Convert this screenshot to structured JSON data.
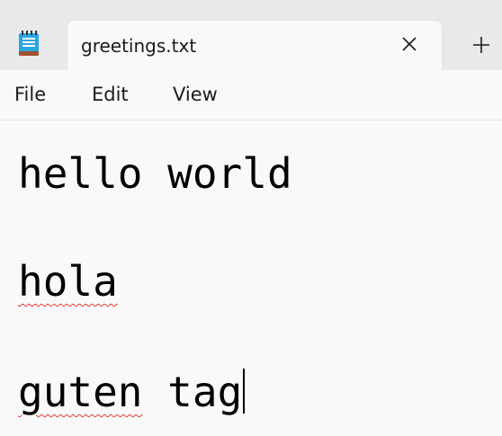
{
  "app": {
    "icon": "notepad-icon",
    "accent_color": "#2aa7e0"
  },
  "tabs": [
    {
      "title": "greetings.txt",
      "close_icon": "close-icon"
    }
  ],
  "new_tab_icon": "plus-icon",
  "menu": {
    "file_label": "File",
    "edit_label": "Edit",
    "view_label": "View"
  },
  "editor": {
    "lines": [
      "hello world",
      "",
      "hola",
      "",
      "guten tag"
    ],
    "misspelled_words": [
      "hola",
      "guten"
    ],
    "spellcheck_color": "#e23a3a"
  }
}
